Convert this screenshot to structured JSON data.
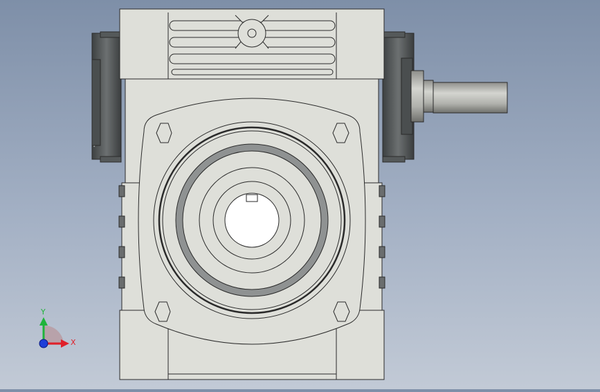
{
  "viewport": {
    "background_top": "#7e8fa8",
    "background_bottom": "#c2cad6"
  },
  "model": {
    "body_color": "#dedfd9",
    "edge_color": "#2a2a2a",
    "dark_part_color": "#55595a",
    "shaft_color": "#b9bab5"
  },
  "triad": {
    "x_label": "X",
    "y_label": "Y",
    "x_color": "#e0202a",
    "y_color": "#1fb43a",
    "z_color": "#1f3fd8"
  }
}
